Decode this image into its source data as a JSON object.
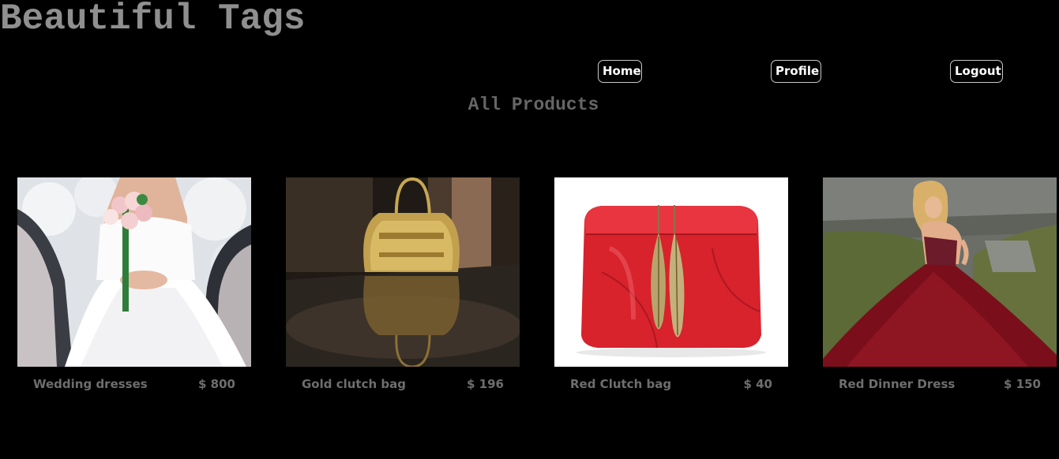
{
  "header": {
    "title": "Beautiful Tags"
  },
  "nav": {
    "home_label": "Home",
    "profile_label": "Profile",
    "logout_label": "Logout"
  },
  "main": {
    "section_title": "All Products",
    "products": [
      {
        "name": "Wedding dresses",
        "price": "$ 800",
        "image": "wedding-dress-photo"
      },
      {
        "name": "Gold clutch bag",
        "price": "$ 196",
        "image": "gold-clutch-bag-photo"
      },
      {
        "name": "Red Clutch bag",
        "price": "$ 40",
        "image": "red-clutch-bag-photo"
      },
      {
        "name": "Red Dinner Dress",
        "price": "$ 150",
        "image": "red-dinner-dress-photo"
      }
    ]
  },
  "colors": {
    "background": "#000000",
    "title_text": "#8f8f8f",
    "section_title_text": "#666666",
    "product_text": "#6e6e6e",
    "nav_text": "#ffffff",
    "nav_border": "#c8c8c8"
  }
}
